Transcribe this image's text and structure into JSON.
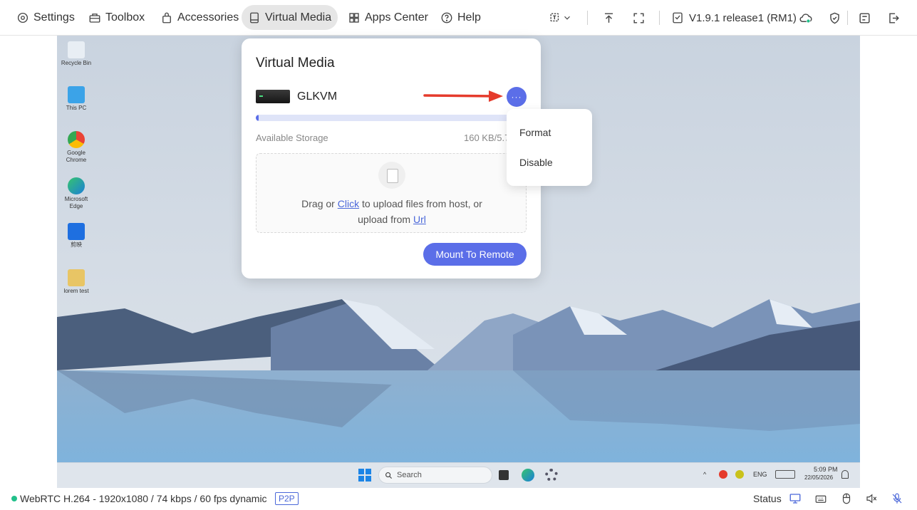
{
  "topbar": {
    "nav": [
      {
        "label": "Settings",
        "icon": "gear-icon"
      },
      {
        "label": "Toolbox",
        "icon": "toolbox-icon"
      },
      {
        "label": "Accessories",
        "icon": "bag-icon"
      },
      {
        "label": "Virtual Media",
        "icon": "drive-icon"
      },
      {
        "label": "Apps Center",
        "icon": "apps-icon"
      },
      {
        "label": "Help",
        "icon": "help-icon"
      }
    ],
    "active_tab": "Virtual Media",
    "version": "V1.9.1 release1 (RM1)"
  },
  "remote": {
    "desktop_icons": [
      "Recycle Bin",
      "This PC",
      "Google Chrome",
      "Microsoft Edge",
      "剪映",
      "lorem test"
    ],
    "taskbar": {
      "search_placeholder": "Search",
      "lang": "ENG",
      "time": "5:09 PM",
      "date": "22/05/2026"
    }
  },
  "virtual_media": {
    "title": "Virtual Media",
    "device_name": "GLKVM",
    "storage_label": "Available Storage",
    "storage_value": "160 KB/5.7",
    "storage_used_fraction": 0.01,
    "upload": {
      "text_prefix": "Drag or ",
      "click_link": "Click",
      "text_middle": " to upload files from host, or",
      "text_line2": "upload from ",
      "url_link": "Url"
    },
    "mount_button": "Mount To Remote",
    "menu": [
      "Format",
      "Disable"
    ]
  },
  "statusbar": {
    "connection": "WebRTC H.264 - 1920x1080 /  74 kbps / 60 fps dynamic",
    "p2p": "P2P",
    "status_label": "Status"
  },
  "colors": {
    "accent": "#5b6ee8",
    "status_ok": "#22c08a",
    "annotation_arrow": "#e53b2c"
  }
}
